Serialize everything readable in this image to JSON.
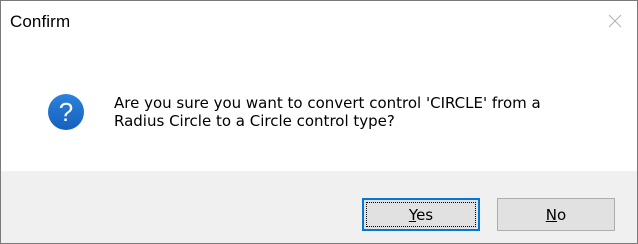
{
  "window": {
    "title": "Confirm",
    "close_icon": "close-icon"
  },
  "message": {
    "icon": "question-icon",
    "icon_color": "#1a6dcc",
    "line1": "Are you sure you want to convert control 'CIRCLE' from a",
    "line2": "Radius Circle to a Circle control type?"
  },
  "buttons": {
    "yes_accel": "Y",
    "yes_rest": "es",
    "no_accel": "N",
    "no_rest": "o"
  },
  "colors": {
    "footer_bg": "#f0f0f0",
    "button_bg": "#e1e1e1",
    "default_button_border": "#0078d7"
  }
}
